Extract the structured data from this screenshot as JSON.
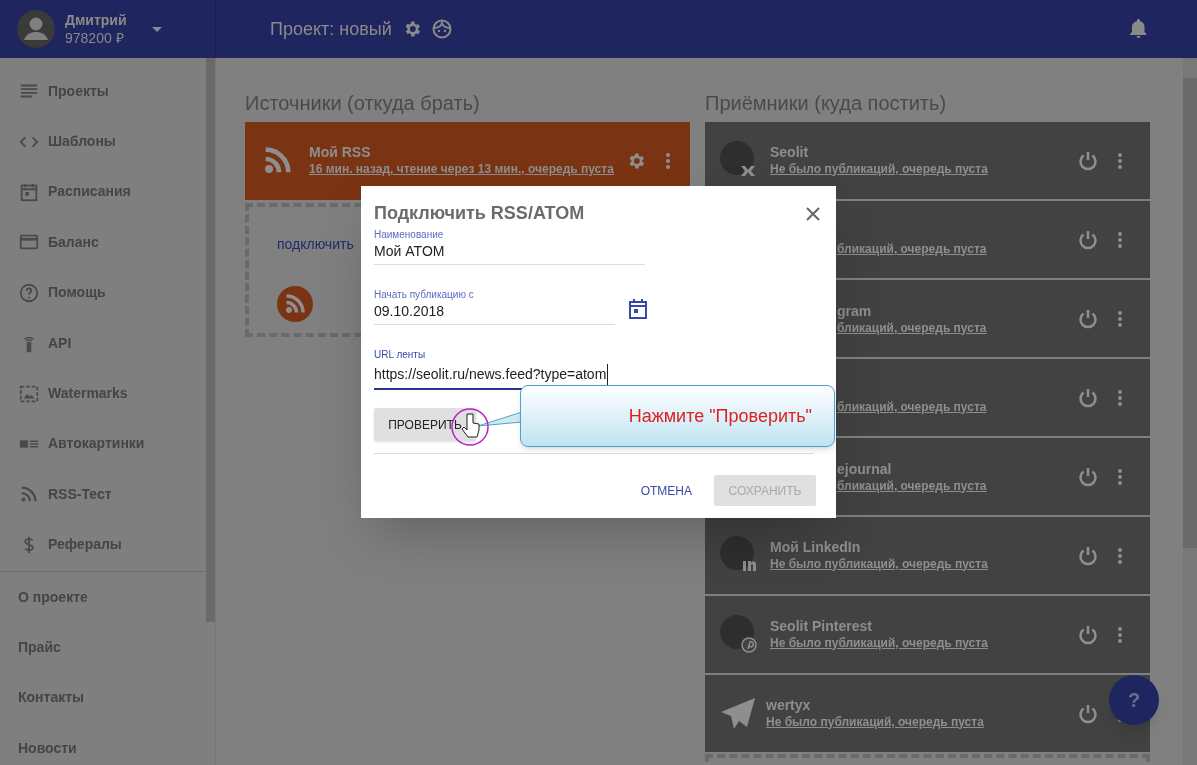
{
  "header": {
    "user_name": "Дмитрий",
    "balance": "978200 ₽",
    "project_title": "Проект: новый"
  },
  "sidebar": {
    "items": [
      {
        "kind": "projects",
        "label": "Проекты"
      },
      {
        "kind": "templates",
        "label": "Шаблоны"
      },
      {
        "kind": "schedule",
        "label": "Расписания"
      },
      {
        "kind": "balance",
        "label": "Баланс"
      },
      {
        "kind": "help",
        "label": "Помощь"
      },
      {
        "kind": "api",
        "label": "API"
      },
      {
        "kind": "watermarks",
        "label": "Watermarks"
      },
      {
        "kind": "autoimages",
        "label": "Автокартинки"
      },
      {
        "kind": "rss",
        "label": "RSS-Тест"
      },
      {
        "kind": "referrals",
        "label": "Рефералы"
      }
    ],
    "links": [
      "О проекте",
      "Прайс",
      "Контакты",
      "Новости"
    ]
  },
  "sources": {
    "heading": "Источники (откуда брать)",
    "cards": [
      {
        "title": "Мой RSS",
        "status": "16 мин. назад, чтение через 13 мин., очередь пуста"
      }
    ],
    "add_card": {
      "label": "подключить"
    }
  },
  "receivers": {
    "heading": "Приёмники (куда постить)",
    "cards": [
      {
        "kind": "vk",
        "name": "Seolit",
        "status": "Не было публикаций, очередь пуста"
      },
      {
        "kind": "covered",
        "status": "бликаций, очередь пуста"
      },
      {
        "kind": "covered",
        "name": "gram",
        "status": "бликаций, очередь пуста"
      },
      {
        "kind": "covered",
        "status": "бликаций, очередь пуста"
      },
      {
        "kind": "covered",
        "name": "ejournal",
        "status": "бликаций, очередь пуста"
      },
      {
        "kind": "linkedin",
        "name": "Мой LinkedIn",
        "status": "Не было публикаций, очередь пуста"
      },
      {
        "kind": "pinterest",
        "name": "Seolit Pinterest",
        "status": "Не было публикаций, очередь пуста"
      },
      {
        "kind": "telegram",
        "name": "wertyx",
        "status": "Не было публикаций, очередь пуста"
      }
    ]
  },
  "dialog": {
    "title": "Подключить RSS/ATOM",
    "fields": [
      {
        "kind": "text",
        "label": "Наименование",
        "value": "Мой ATOM",
        "focused": false
      },
      {
        "kind": "date",
        "label": "Начать публикацию с",
        "value": "09.10.2018",
        "focused": false
      },
      {
        "kind": "url",
        "label": "URL ленты",
        "value": "https://seolit.ru/news.feed?type=atom",
        "focused": true
      }
    ],
    "check_button": "ПРОВЕРИТЬ",
    "cancel_button": "ОТМЕНА",
    "save_button": {
      "label": "СОХРАНИТЬ",
      "disabled": true
    }
  },
  "callout": {
    "text": "Нажмите \"Проверить\""
  },
  "help_button": "?"
}
